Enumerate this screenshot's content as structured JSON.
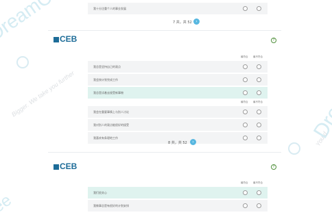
{
  "watermark": {
    "brand_left": "DreamCareer",
    "tagline_left": "Bigger. We take you further",
    "brand_right": "Dre",
    "tagline_right": "You d",
    "fragment_bottom_left": "ee"
  },
  "section_top": {
    "rows": [
      {
        "text": "我十分注重个人的事业发展"
      }
    ],
    "pager_text": "7 共，共 52",
    "next_label": "›"
  },
  "section_mid": {
    "logo_text": "CEB",
    "help_label": "?",
    "headers": {
      "most": "最符合",
      "least": "最不符合"
    },
    "group1": [
      {
        "text": "我总是坚持自己的观点"
      },
      {
        "text": "我会按计划完成工作"
      },
      {
        "text": "我总是试着去接受新事物"
      }
    ],
    "group2": [
      {
        "text": "我会在重要事情上与别人讨论"
      },
      {
        "text": "我对别人的观点能很好的接受"
      },
      {
        "text": "我喜欢有条理地工作"
      }
    ],
    "pager_text": "8 共，共 52",
    "next_label": "›"
  },
  "section_bottom": {
    "logo_text": "CEB",
    "help_label": "?",
    "headers": {
      "most": "最符合",
      "least": "最不符合"
    },
    "rows": [
      {
        "text": "我们很关心"
      },
      {
        "text": "我做事总是有很好的计划安排"
      }
    ]
  }
}
